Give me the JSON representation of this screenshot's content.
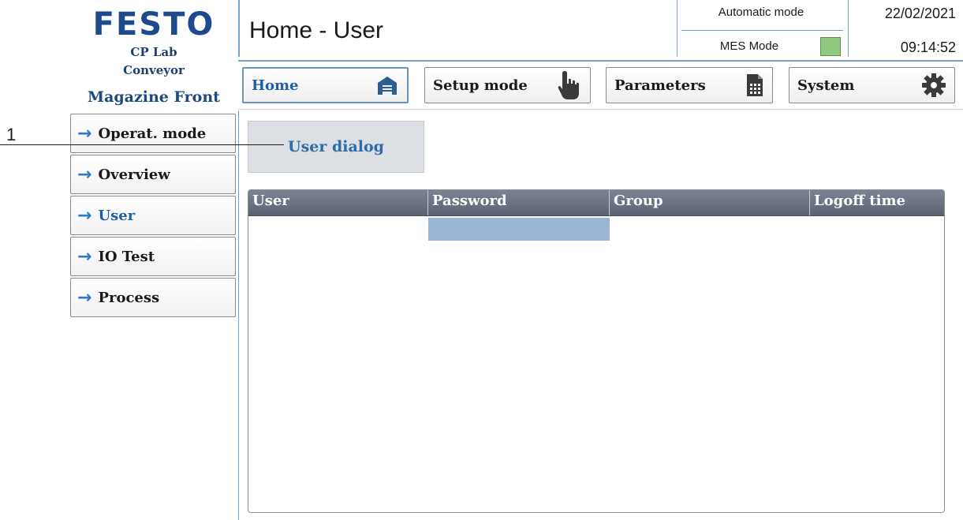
{
  "brand": {
    "logo_text": "FESTO",
    "line1": "CP Lab",
    "line2": "Conveyor",
    "line3": "Magazine Front"
  },
  "header": {
    "title": "Home - User",
    "automatic_mode": "Automatic mode",
    "mes_mode": "MES Mode",
    "mes_led_color": "#8ec97f",
    "date": "22/02/2021",
    "time": "09:14:52"
  },
  "topnav": [
    {
      "label": "Home",
      "icon": "house-icon",
      "active": true
    },
    {
      "label": "Setup mode",
      "icon": "hand-pointer-icon"
    },
    {
      "label": "Parameters",
      "icon": "document-icon"
    },
    {
      "label": "System",
      "icon": "gear-icon"
    }
  ],
  "sidenav": [
    {
      "label": "Operat. mode"
    },
    {
      "label": "Overview"
    },
    {
      "label": "User",
      "active": true
    },
    {
      "label": "IO Test"
    },
    {
      "label": "Process"
    }
  ],
  "annotation": {
    "number": "1"
  },
  "main": {
    "dialog_button": "User dialog",
    "table": {
      "columns": [
        "User",
        "Password",
        "Group",
        "Logoff time"
      ],
      "rows": []
    }
  },
  "colors": {
    "accent": "#1f5fa6",
    "header_bar": "#5b6272",
    "selection": "#9bb5d6"
  }
}
